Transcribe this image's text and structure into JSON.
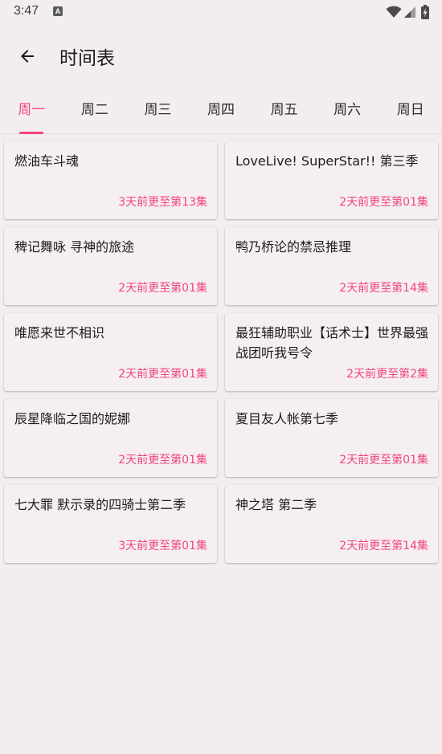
{
  "status_bar": {
    "time": "3:47",
    "a_icon_glyph": "A",
    "icons": [
      "a-notification-icon",
      "wifi-icon",
      "signal-icon",
      "battery-icon"
    ]
  },
  "app_bar": {
    "title": "时间表",
    "back_icon": "arrow-left-icon"
  },
  "tabs": [
    {
      "label": "周一",
      "active": true
    },
    {
      "label": "周二",
      "active": false
    },
    {
      "label": "周三",
      "active": false
    },
    {
      "label": "周四",
      "active": false
    },
    {
      "label": "周五",
      "active": false
    },
    {
      "label": "周六",
      "active": false
    },
    {
      "label": "周日",
      "active": false
    }
  ],
  "cards": [
    {
      "title": "燃油车斗魂",
      "update": "3天前更至第13集"
    },
    {
      "title": "LoveLive! SuperStar!! 第三季",
      "update": "2天前更至第01集"
    },
    {
      "title": "稗记舞咏 寻神的旅途",
      "update": "2天前更至第01集"
    },
    {
      "title": "鸭乃桥论的禁忌推理",
      "update": "2天前更至第14集"
    },
    {
      "title": "唯愿来世不相识",
      "update": "2天前更至第01集"
    },
    {
      "title": "最狂辅助职业【话术士】世界最强战团听我号令",
      "update": "2天前更至第2集"
    },
    {
      "title": "辰星降临之国的妮娜",
      "update": "2天前更至第01集"
    },
    {
      "title": "夏目友人帐第七季",
      "update": "2天前更至第01集"
    },
    {
      "title": "七大罪 默示录的四骑士第二季",
      "update": "3天前更至第01集"
    },
    {
      "title": "神之塔 第二季",
      "update": "2天前更至第14集"
    }
  ],
  "colors": {
    "accent": "#F0457E",
    "background": "#F4EDEF",
    "card": "#F6EFF1"
  }
}
